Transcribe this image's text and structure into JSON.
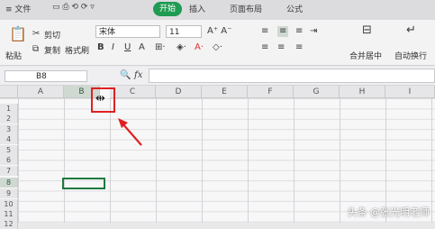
{
  "topbar": {
    "menu_label": "≡ 文件",
    "start_tab": "开始",
    "insert_tab": "插入",
    "layout_tab": "页面布局",
    "formula_tab": "公式"
  },
  "ribbon": {
    "cut": "剪切",
    "paste": "粘贴",
    "copy": "复制",
    "format_painter": "格式刷",
    "font_name": "宋体",
    "font_size": "11",
    "merge_center": "合并居中",
    "wrap_text": "自动换行"
  },
  "formula_bar": {
    "name_box": "B8",
    "fx": "fx"
  },
  "columns": [
    "A",
    "B",
    "C",
    "D",
    "E",
    "F",
    "G",
    "H",
    "I"
  ],
  "rows": [
    "1",
    "2",
    "3",
    "4",
    "5",
    "6",
    "7",
    "8",
    "9",
    "10",
    "11",
    "12"
  ],
  "watermark": "头条 @张光明老师",
  "colors": {
    "accent": "#1f9b52",
    "selection": "#1e7a3e",
    "highlight": "#e02020"
  },
  "icons": [
    "resize-cursor-icon",
    "arrow-annotation-icon"
  ]
}
